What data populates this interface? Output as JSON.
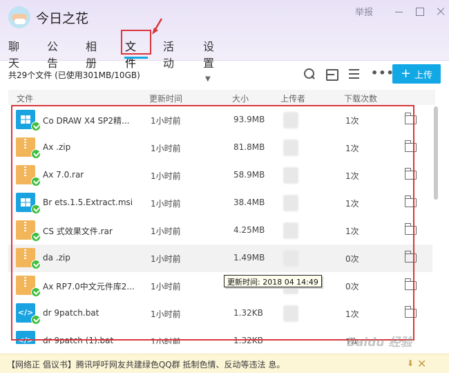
{
  "window": {
    "title": "今日之花",
    "report_label": "举报"
  },
  "tabs": [
    {
      "label": "聊天"
    },
    {
      "label": "公告"
    },
    {
      "label": "相册"
    },
    {
      "label": "文件"
    },
    {
      "label": "活动"
    },
    {
      "label": "设置"
    }
  ],
  "toolbar": {
    "count_text": "共29个文件 (已使用301MB/10GB)",
    "upload_label": "上传",
    "more_label": "•••"
  },
  "columns": {
    "file": "文件",
    "updated": "更新时间",
    "size": "大小",
    "uploader": "上传者",
    "downloads": "下载次数"
  },
  "files": [
    {
      "name": "Co     DRAW X4 SP2精...",
      "icon": "msi",
      "updated": "1小时前",
      "size": "93.9MB",
      "uploader": "A",
      "downloads": "1次"
    },
    {
      "name": "Ax      .zip",
      "icon": "zip",
      "updated": "1小时前",
      "size": "81.8MB",
      "uploader": "A",
      "downloads": "1次"
    },
    {
      "name": "Ax      7.0.rar",
      "icon": "zip",
      "updated": "1小时前",
      "size": "58.9MB",
      "uploader": "A",
      "downloads": "1次"
    },
    {
      "name": "Br      ets.1.5.Extract.msi",
      "icon": "msi",
      "updated": "1小时前",
      "size": "38.4MB",
      "uploader": "A",
      "downloads": "1次"
    },
    {
      "name": "CS      式效果文件.rar",
      "icon": "zip",
      "updated": "1小时前",
      "size": "4.25MB",
      "uploader": "A",
      "downloads": "1次"
    },
    {
      "name": "da      .zip",
      "icon": "zip",
      "updated": "1小时前",
      "size": "1.49MB",
      "uploader": "A",
      "downloads": "0次"
    },
    {
      "name": "Ax      RP7.0中文元件库2...",
      "icon": "zip",
      "updated": "1小时前",
      "size": "",
      "uploader": "A",
      "downloads": "0次"
    },
    {
      "name": "dr      9patch.bat",
      "icon": "bat",
      "updated": "1小时前",
      "size": "1.32KB",
      "uploader": "A",
      "downloads": "1次"
    },
    {
      "name": "dr      9patch (1).bat",
      "icon": "bat",
      "updated": "1小时前",
      "size": "1.32KB",
      "uploader": "A",
      "downloads": "1次"
    }
  ],
  "tooltip": "更新时间: 2018      04 14:49",
  "notice": "【网络正      倡议书】腾讯呼吁网友共建绿色QQ群 抵制色情、反动等违法      息。",
  "watermark": "Baidu 经验",
  "colors": {
    "accent": "#12a8e6",
    "highlight_red": "#d9353a",
    "header_bg": "#ece6f7",
    "notice_bg": "#fdf6d6"
  }
}
